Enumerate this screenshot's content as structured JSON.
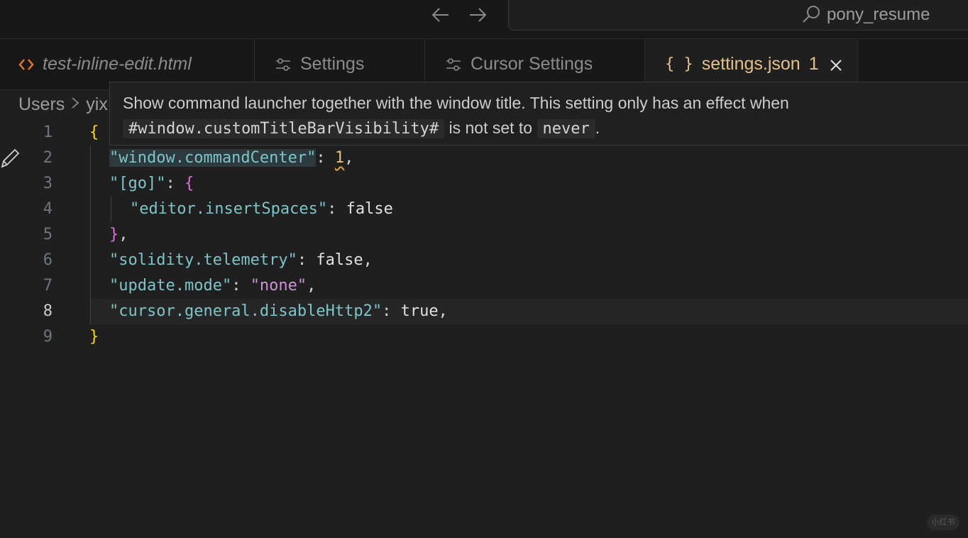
{
  "titlebar": {
    "back_icon": "arrow-left-icon",
    "forward_icon": "arrow-right-icon",
    "command_center_label": "pony_resume"
  },
  "tabs": [
    {
      "label": "test-inline-edit.html",
      "icon": "html-code-icon",
      "icon_color": "#e37933",
      "italic": true
    },
    {
      "label": "Settings",
      "icon": "settings-sliders-icon"
    },
    {
      "label": "Cursor Settings",
      "icon": "settings-sliders-icon"
    },
    {
      "label": "settings.json",
      "icon": "json-braces-icon",
      "badge": "1",
      "active": true,
      "color": "#e2c08d"
    }
  ],
  "breadcrumb": {
    "root": "Users",
    "next": "yix"
  },
  "hover": {
    "text1": "Show command launcher together with the window title. This setting only has an effect when",
    "code1": "#window.customTitleBarVisibility#",
    "text2": "is not set to",
    "code2": "never",
    "text3": "."
  },
  "gutter": [
    "1",
    "2",
    "3",
    "4",
    "5",
    "6",
    "7",
    "8",
    "9"
  ],
  "code": {
    "l1_open": "{",
    "l2_key": "\"window.commandCenter\"",
    "l2_colon": ": ",
    "l2_val": "1",
    "l2_comma": ",",
    "l3_key": "\"[go]\"",
    "l3_colon": ": ",
    "l3_brace": "{",
    "l4_key": "\"editor.insertSpaces\"",
    "l4_colon": ": ",
    "l4_val": "false",
    "l5_brace": "}",
    "l5_comma": ",",
    "l6_key": "\"solidity.telemetry\"",
    "l6_colon": ": ",
    "l6_val": "false",
    "l6_comma": ",",
    "l7_key": "\"update.mode\"",
    "l7_colon": ": ",
    "l7_val": "\"none\"",
    "l7_comma": ",",
    "l8_key": "\"cursor.general.disableHttp2\"",
    "l8_colon": ": ",
    "l8_val": "true",
    "l8_comma": ",",
    "l9_close": "}"
  },
  "current_line": "8",
  "watermark": "小红书",
  "colors": {
    "accent": "#e2c08d",
    "string_key": "#7ec4c9",
    "string_value": "#ce93d8",
    "brace": "#ffd700"
  }
}
